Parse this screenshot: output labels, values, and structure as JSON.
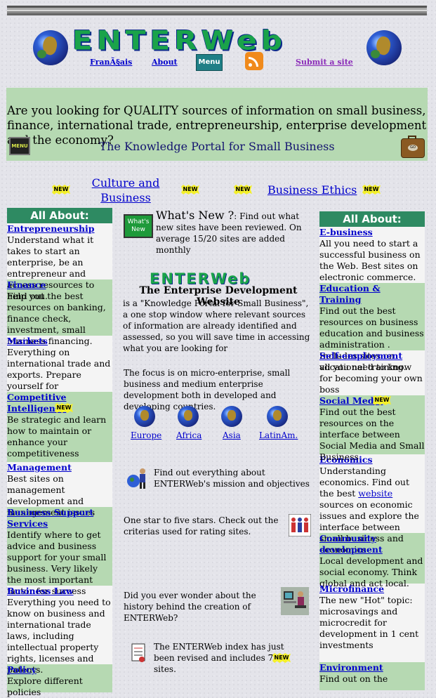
{
  "header": {
    "logo": "ENTERWeb",
    "nav": {
      "french": "FranÃ§ais",
      "about": "About",
      "menu": "Menu",
      "submit": "Submit a site"
    }
  },
  "banner": {
    "question": "Are you looking for QUALITY sources of information on small business, finance, international trade, entrepreneurship, enterprise development and the economy?",
    "portal": "The Knowledge Portal for Small Business",
    "menu_icon": "MENU",
    "suitcase_icon": "GO"
  },
  "new_badge": "NEW",
  "links_row": {
    "culture": "Culture and Business",
    "ethics": "Business Ethics"
  },
  "left": {
    "header": "All About:",
    "items": [
      {
        "title": "Entrepreneurship",
        "text": "Understand what it takes to start an enterprise, be an entrepreneur and access resources to help you."
      },
      {
        "title": "Finance",
        "text": "Find out the best resources on banking, finance check, investment, small business financing."
      },
      {
        "title": "Markets",
        "text": "Everything on international trade and exports. Prepare yourself for globalization"
      },
      {
        "title": "Competitive Intelligence",
        "text": "Be strategic and learn how to maintain or enhance your competitiveness"
      },
      {
        "title": "Management",
        "text": "Best sites on management development and management issues"
      },
      {
        "title": "Business Support Services",
        "text": "Identify where to get advice and business support for your small business. Very likely the most important factor for success"
      },
      {
        "title": "Business Law",
        "text": "Everything you need to know on business and international trade laws, including intellectual property rights, licenses and patents."
      },
      {
        "title": "Policy",
        "text": "Explore different policies"
      }
    ]
  },
  "right": {
    "header": "All About:",
    "items": [
      {
        "title": "E-business",
        "text": "All you need to start a successful business on the Web. Best sites on electronic commerce."
      },
      {
        "title": "Education & Training",
        "text": "Find out the best resources on business education and business administration . Includes sites on vocational training."
      },
      {
        "title": "Self-employment",
        "text": "all you need to know for becoming your own boss"
      },
      {
        "title": "Social Media",
        "text": "Find out the best resources on the interface between Social Media and Small Business"
      },
      {
        "title": "Economics",
        "text_a": "Understanding economics. Find out the best ",
        "link": "website",
        "text_b": " sources on economic issues and explore the interface between small business and economics"
      },
      {
        "title": "Community development",
        "text": "Local development and social economy. Think global and act local."
      },
      {
        "title": "Microfinance",
        "text": "The new \"Hot\" topic: microsavings and microcredit for development in 1 cent investments"
      },
      {
        "title": "Environment",
        "text": "Find out on the"
      }
    ]
  },
  "middle": {
    "whats_new_icon": "What's New",
    "whats_new_title": "What's New ?",
    "whats_new_text": ": Find out what new sites have been reviewed. On average 15/20 sites are added monthly",
    "logo": "ENTERWeb",
    "site_title": "The Enterprise Development Website",
    "intro": "is a \"Knowledge Portal for Small Business\", a one stop window where relevant sources of information are already identified and assessed, so you will save time in accessing what you are looking for",
    "focus": "The focus is on micro-enterprise, small business and medium enterprise development both in developed and developing countries.",
    "regions": [
      "Europe",
      "Africa",
      "Asia",
      "LatinAm."
    ],
    "mission": "Find out everything about ENTERWeb's mission and objectives",
    "stars": "One star to five stars. Check out the criterias used for rating sites.",
    "history": "Did you ever wonder about the history behind the creation of ENTERWeb?",
    "index": "The ENTERWeb index has just been revised and includes 746 sites."
  }
}
